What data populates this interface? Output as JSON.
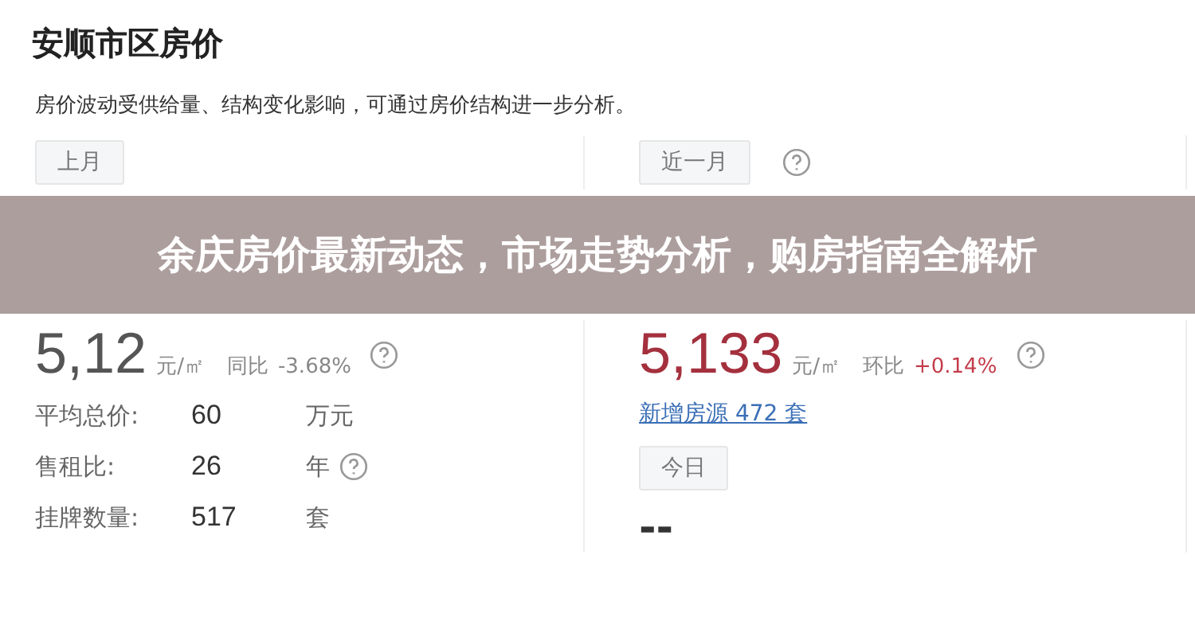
{
  "page": {
    "title": "安顺市区房价",
    "description": "房价波动受供给量、结构变化影响，可通过房价结构进一步分析。"
  },
  "left": {
    "period_tag": "上月",
    "price": {
      "value": "5,12",
      "unit": "元/㎡",
      "change_label": "同比",
      "change": "-3.68%",
      "kind": "fall",
      "help": true
    },
    "stats": [
      {
        "label": "平均总价:",
        "value": "60",
        "unit": "万元",
        "help": false
      },
      {
        "label": "售租比:",
        "value": "26",
        "unit": "年",
        "help": true
      },
      {
        "label": "挂牌数量:",
        "value": "517",
        "unit": "套",
        "help": false
      }
    ]
  },
  "right": {
    "period_tag": "近一月",
    "tag_help": true,
    "price": {
      "value": "5,133",
      "unit": "元/㎡",
      "change_label": "环比",
      "change": "+0.14%",
      "kind": "rise",
      "help": true
    },
    "new_listings_link": "新增房源 472 套",
    "today_tag": "今日",
    "today_value": "--"
  },
  "banner": {
    "title": "余庆房价最新动态，市场走势分析，购房指南全解析"
  }
}
